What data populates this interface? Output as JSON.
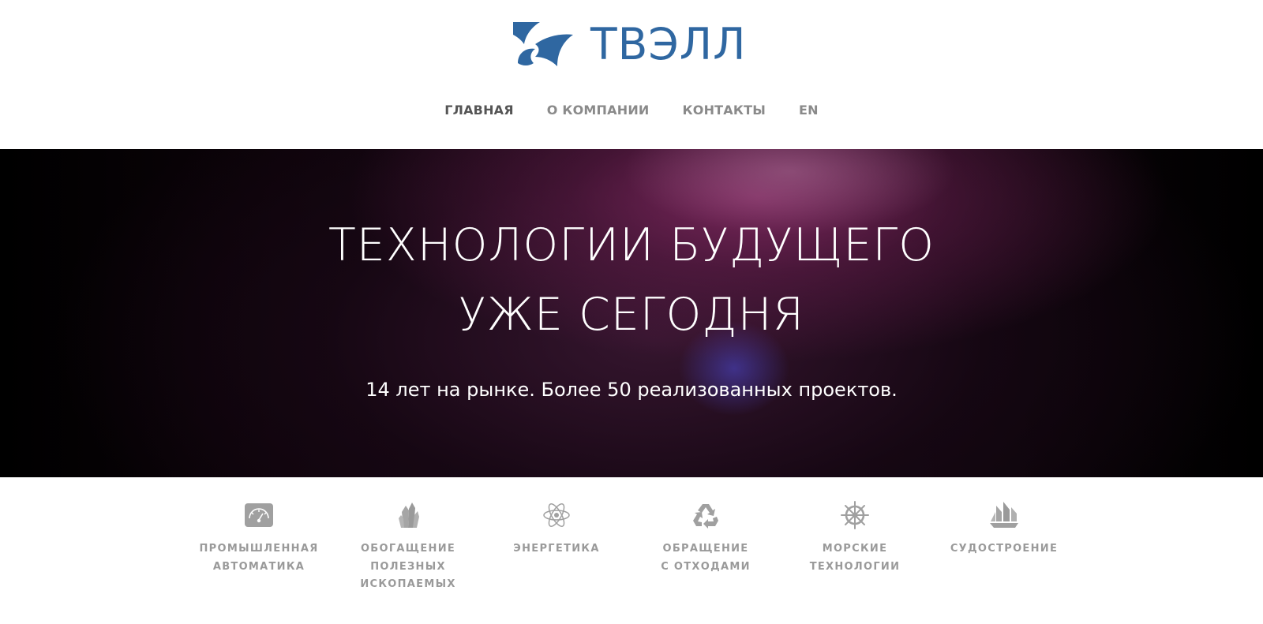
{
  "header": {
    "logo_text": "ТВЭЛЛ",
    "brand_color": "#2f67a1"
  },
  "nav": {
    "items": [
      {
        "label": "ГЛАВНАЯ",
        "active": true
      },
      {
        "label": "О КОМПАНИИ",
        "active": false
      },
      {
        "label": "КОНТАКТЫ",
        "active": false
      },
      {
        "label": "EN",
        "active": false
      }
    ]
  },
  "hero": {
    "title_line1": "ТЕХНОЛОГИИ БУДУЩЕГО",
    "title_line2": "УЖЕ СЕГОДНЯ",
    "subtitle": "14 лет на рынке. Более 50 реализованных проектов."
  },
  "features": {
    "items": [
      {
        "label": "ПРОМЫШЛЕННАЯ\nАВТОМАТИКА",
        "icon": "gauge-icon"
      },
      {
        "label": "ОБОГАЩЕНИЕ\nПОЛЕЗНЫХ\nИСКОПАЕМЫХ",
        "icon": "crystal-icon"
      },
      {
        "label": "ЭНЕРГЕТИКА",
        "icon": "atom-icon"
      },
      {
        "label": "ОБРАЩЕНИЕ\nС ОТХОДАМИ",
        "icon": "recycle-icon"
      },
      {
        "label": "МОРСКИЕ\nТЕХНОЛОГИИ",
        "icon": "ship-wheel-icon"
      },
      {
        "label": "СУДОСТРОЕНИЕ",
        "icon": "sailing-ship-icon"
      }
    ],
    "icon_color": "#9a9a9a"
  }
}
